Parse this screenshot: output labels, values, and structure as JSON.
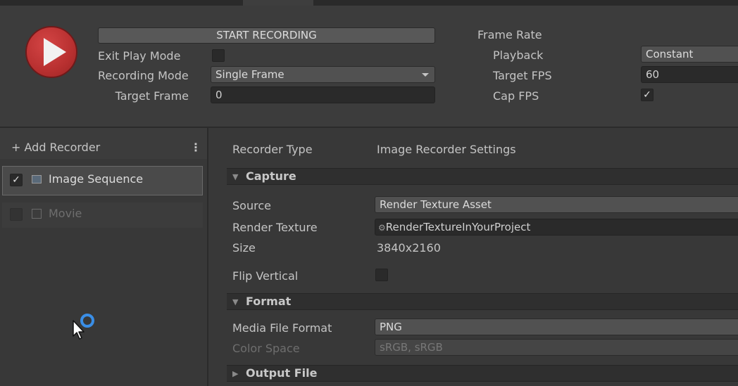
{
  "header": {
    "start_recording": "START RECORDING",
    "exit_play_mode_label": "Exit Play Mode",
    "exit_play_mode_checked": false,
    "recording_mode_label": "Recording Mode",
    "recording_mode_value": "Single Frame",
    "target_frame_label": "Target Frame",
    "target_frame_value": "0",
    "frame_rate_label": "Frame Rate",
    "playback_label": "Playback",
    "playback_value": "Constant",
    "target_fps_label": "Target FPS",
    "target_fps_value": "60",
    "cap_fps_label": "Cap FPS",
    "cap_fps_checked": true
  },
  "sidebar": {
    "add_recorder": "+ Add Recorder",
    "more_icon": "⋮",
    "items": [
      {
        "label": "Image Sequence",
        "checked": true,
        "enabled": true,
        "icon": "image-icon"
      },
      {
        "label": "Movie",
        "checked": false,
        "enabled": false,
        "icon": "film-icon"
      }
    ]
  },
  "main": {
    "recorder_type_label": "Recorder Type",
    "recorder_type_value": "Image Recorder Settings",
    "capture_title": "Capture",
    "source_label": "Source",
    "source_value": "Render Texture Asset",
    "render_texture_label": "Render Texture",
    "render_texture_value": "RenderTextureInYourProject",
    "size_label": "Size",
    "size_value": "3840x2160",
    "flip_vertical_label": "Flip Vertical",
    "flip_vertical_checked": false,
    "format_title": "Format",
    "media_file_format_label": "Media File Format",
    "media_file_format_value": "PNG",
    "color_space_label": "Color Space",
    "color_space_value": "sRGB, sRGB",
    "output_file_title": "Output File"
  },
  "colors": {
    "record_button": "#b83030",
    "background": "#383838",
    "field": "#2a2a2a",
    "busy_cursor": "#3a8ee6"
  }
}
